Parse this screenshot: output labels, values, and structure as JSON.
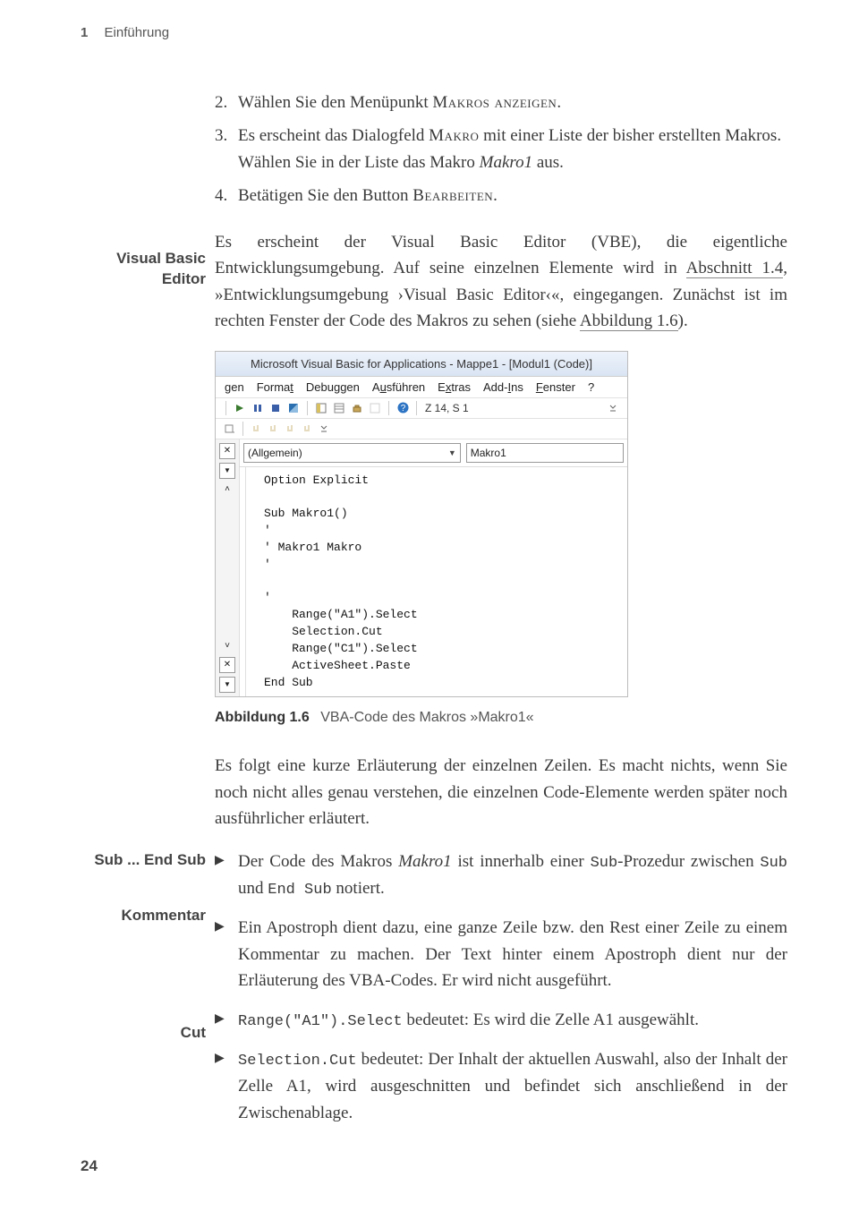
{
  "header": {
    "chapter_number": "1",
    "chapter_title": "Einführung"
  },
  "steps": [
    {
      "n": "2.",
      "pre": "Wählen Sie den Menüpunkt ",
      "sc": "Makros anzeigen",
      "post": "."
    },
    {
      "n": "3.",
      "pre": "Es erscheint das Dialogfeld ",
      "sc": "Makro",
      "mid": " mit einer Liste der bisher erstellten Makros. Wählen Sie in der Liste das Makro ",
      "it": "Makro1",
      "post": " aus."
    },
    {
      "n": "4.",
      "pre": "Betätigen Sie den Button ",
      "sc": "Bearbeiten",
      "post": "."
    }
  ],
  "margin": {
    "vbe": "Visual Basic Editor",
    "sub": "Sub ... End Sub",
    "kommentar": "Kommentar",
    "cut": "Cut"
  },
  "para_vbe": {
    "t1": "Es erscheint der Visual Basic Editor (VBE), die eigentliche Entwicklungsumgebung. Auf seine einzelnen Elemente wird in ",
    "link1": "Abschnitt 1.4",
    "t2": ", »Entwicklungsumgebung ›Visual Basic Editor‹«, eingegangen. Zunächst ist im rechten Fenster der Code des Makros zu sehen (siehe ",
    "link2": "Abbildung 1.6",
    "t3": ")."
  },
  "vbe": {
    "title": "Microsoft Visual Basic for Applications - Mappe1 - [Modul1 (Code)]",
    "menu_gen": "gen",
    "menu_format_pre": "Forma",
    "menu_format_u": "t",
    "menu_debug": "Debuggen",
    "menu_aus_pre": "A",
    "menu_aus_u": "u",
    "menu_aus_post": "sführen",
    "menu_ext_pre": "E",
    "menu_ext_u": "x",
    "menu_ext_post": "tras",
    "menu_add_pre": "Add-",
    "menu_add_u": "I",
    "menu_add_post": "ns",
    "menu_fen_u": "F",
    "menu_fen_post": "enster",
    "menu_help": "?",
    "cursor": "Z 14, S 1",
    "dd_left": "(Allgemein)",
    "dd_right": "Makro1",
    "code": "Option Explicit\n\nSub Makro1()\n'\n' Makro1 Makro\n'\n\n'\n    Range(\"A1\").Select\n    Selection.Cut\n    Range(\"C1\").Select\n    ActiveSheet.Paste\nEnd Sub"
  },
  "caption": {
    "label": "Abbildung 1.6",
    "text": "VBA-Code des Makros »Makro1«"
  },
  "para_after": "Es folgt eine kurze Erläuterung der einzelnen Zeilen. Es macht nichts, wenn Sie noch nicht alles genau verstehen, die einzelnen Code-Elemente werden später noch ausführlicher erläutert.",
  "bullets": {
    "b1": {
      "t1": "Der Code des Makros ",
      "it": "Makro1",
      "t2": " ist innerhalb einer ",
      "m1": "Sub",
      "t3": "-Prozedur zwischen ",
      "m2": "Sub",
      "t4": " und ",
      "m3": "End Sub",
      "t5": " notiert."
    },
    "b2": "Ein Apostroph dient dazu, eine ganze Zeile bzw. den Rest einer Zeile zu einem Kommentar zu machen. Der Text hinter einem Apostroph dient nur der Erläuterung des VBA-Codes. Er wird nicht ausgeführt.",
    "b3": {
      "m": "Range(\"A1\").Select",
      "t": " bedeutet: Es wird die Zelle A1 ausgewählt."
    },
    "b4": {
      "m": "Selection.Cut",
      "t": " bedeutet: Der Inhalt der aktuellen Auswahl, also der Inhalt der Zelle A1, wird ausgeschnitten und befindet sich anschließend in der Zwischenablage."
    }
  },
  "page_number": "24",
  "glyphs": {
    "tri": "▶",
    "chev": "▼",
    "x": "✕",
    "caret_up": "˄",
    "caret_down": "˅"
  }
}
